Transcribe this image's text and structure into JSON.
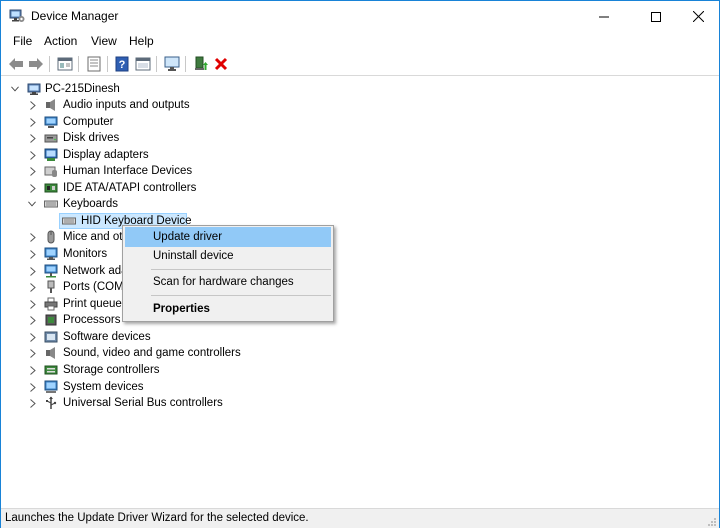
{
  "window": {
    "title": "Device Manager"
  },
  "menubar": {
    "items": [
      "File",
      "Action",
      "View",
      "Help"
    ]
  },
  "toolbar": {
    "buttons": [
      "back-arrow-icon",
      "forward-arrow-icon",
      "properties-icon",
      "show-hide-icon",
      "help-icon",
      "action-view-icon",
      "monitor-scan-icon",
      "enable-device-icon",
      "uninstall-x-icon"
    ]
  },
  "tree": {
    "root": "PC-215Dinesh",
    "categories": [
      "Audio inputs and outputs",
      "Computer",
      "Disk drives",
      "Display adapters",
      "Human Interface Devices",
      "IDE ATA/ATAPI controllers",
      "Keyboards",
      "Mice and ot",
      "Monitors",
      "Network ada",
      "Ports (COM",
      "Print queues",
      "Processors",
      "Software devices",
      "Sound, video and game controllers",
      "Storage controllers",
      "System devices",
      "Universal Serial Bus controllers"
    ],
    "selected_child": "HID Keyboard Device"
  },
  "context_menu": {
    "items": [
      "Update driver",
      "Uninstall device",
      "Scan for hardware changes",
      "Properties"
    ]
  },
  "status": {
    "text": "Launches the Update Driver Wizard for the selected device."
  },
  "colors": {
    "selection": "#cce8ff",
    "menu_highlight": "#91c9f7",
    "window_border": "#1883d7",
    "close_red": "#e81123"
  }
}
